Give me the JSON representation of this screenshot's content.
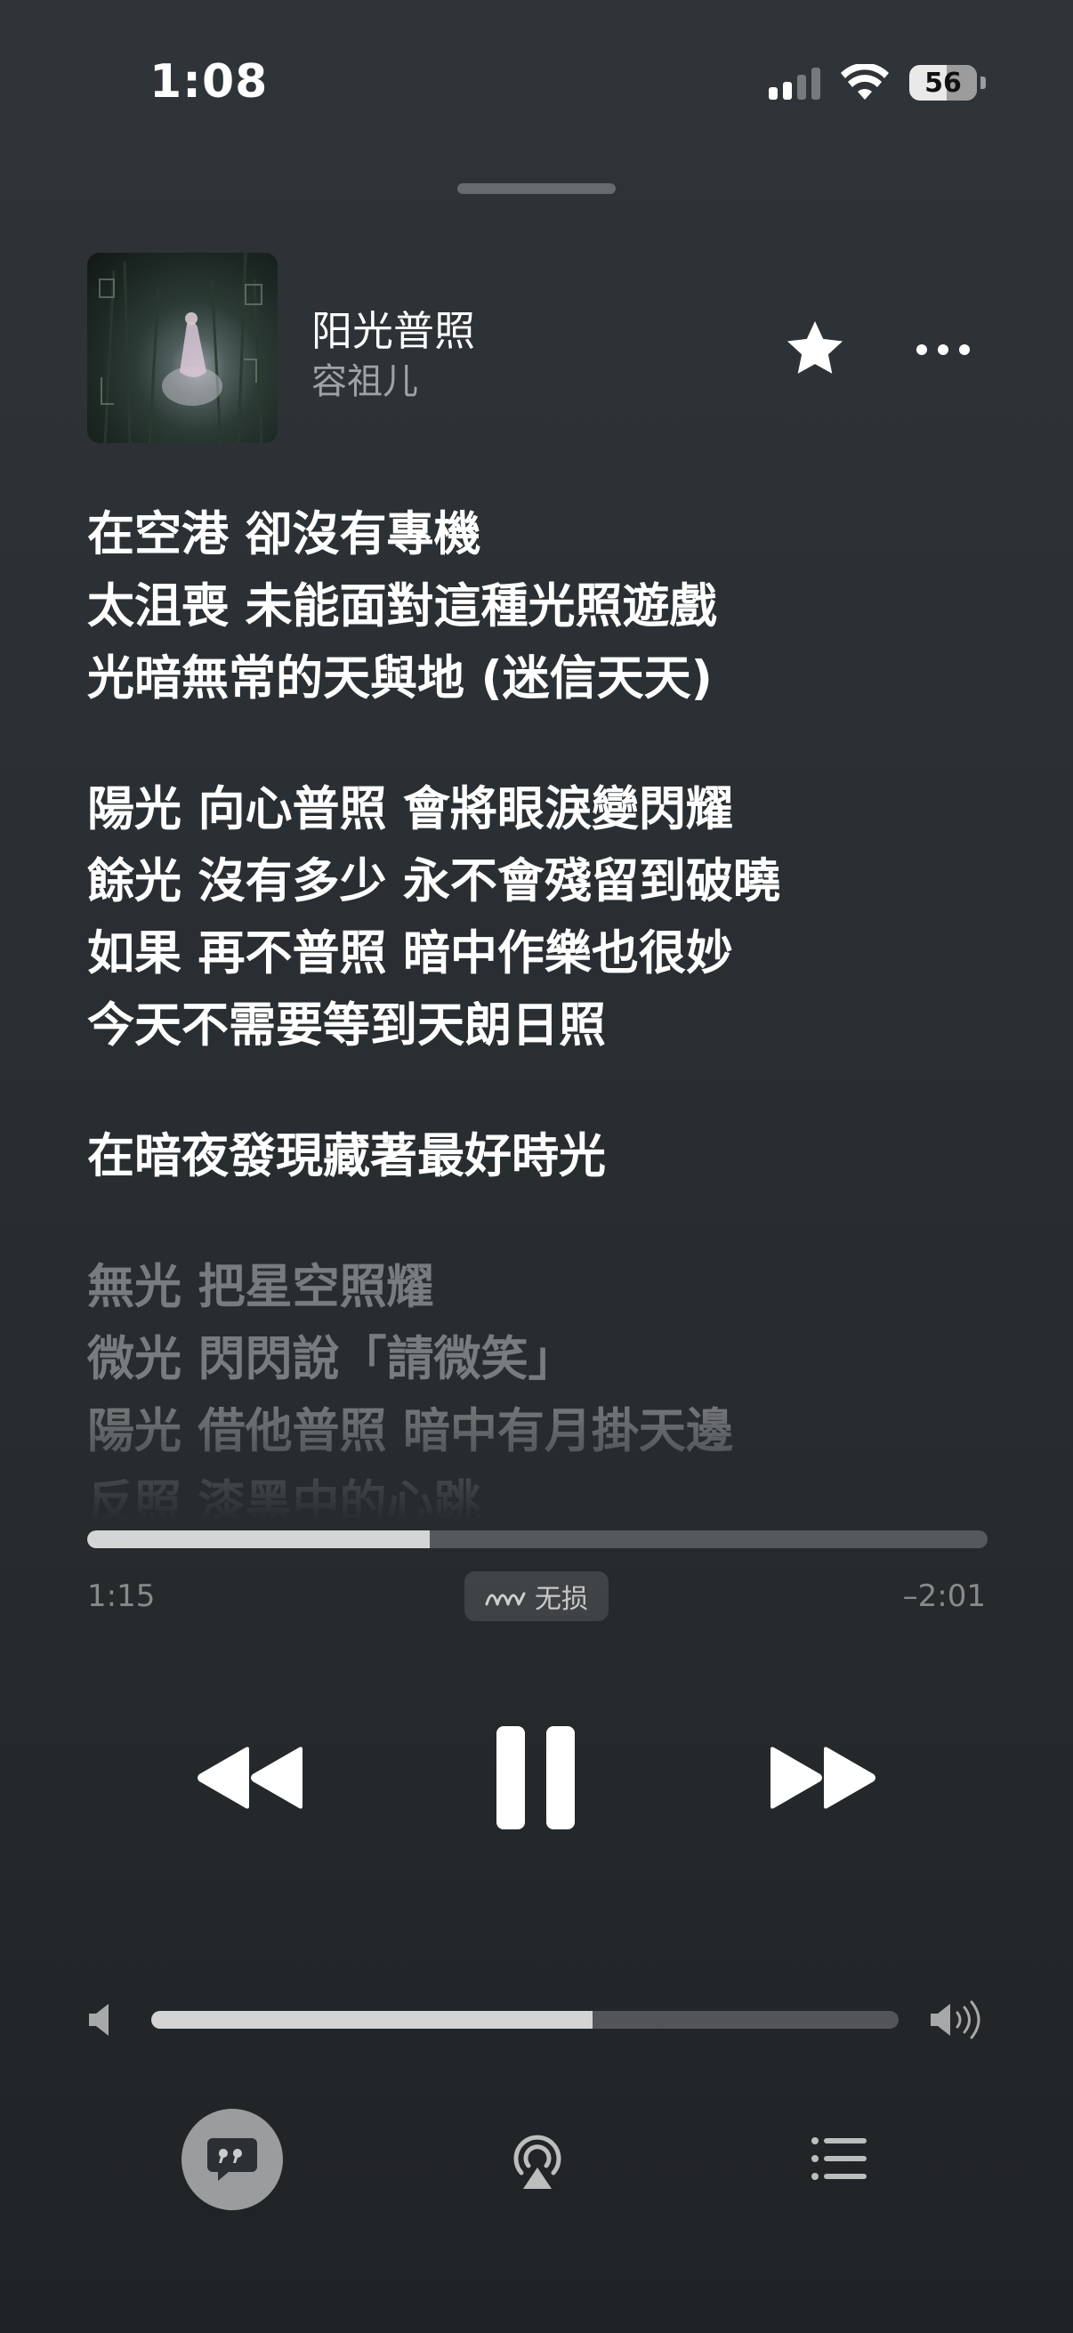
{
  "status_bar": {
    "time": "1:08",
    "battery_percent": "56",
    "icons": [
      "cellular-signal-icon",
      "wifi-icon",
      "battery-icon"
    ]
  },
  "now_playing": {
    "title": "阳光普照",
    "artist": "容祖儿",
    "favorite_icon": "star-icon",
    "more_icon": "ellipsis-icon"
  },
  "lyrics": {
    "blocks": [
      [
        "在空港 卻沒有專機",
        "太沮喪 未能面對這種光照遊戲",
        "光暗無常的天與地 (迷信天天)"
      ],
      [
        "陽光 向心普照 會將眼淚變閃耀",
        "餘光 沒有多少 永不會殘留到破曉",
        "如果 再不普照 暗中作樂也很妙",
        "今天不需要等到天朗日照"
      ],
      [
        "在暗夜發現藏著最好時光"
      ],
      [
        "無光 把星空照耀",
        "微光 閃閃說「請微笑」",
        "陽光 借他普照 暗中有月掛天邊",
        "反照 漆黑中的心跳"
      ]
    ]
  },
  "playback": {
    "elapsed": "1:15",
    "remaining": "–2:01",
    "progress_fraction": 0.38,
    "quality_badge": "无损",
    "quality_icon": "lossless-waveform-icon",
    "controls": [
      "rewind-icon",
      "pause-icon",
      "fast-forward-icon"
    ]
  },
  "volume": {
    "level_fraction": 0.59,
    "icons": [
      "speaker-min-icon",
      "speaker-max-icon"
    ]
  },
  "bottom_bar": {
    "items": [
      "lyrics-quote-icon",
      "airplay-icon",
      "queue-list-icon"
    ]
  },
  "colors": {
    "background_top": "#2f3438",
    "background_bottom": "#202325",
    "text_primary": "#ffffff",
    "text_secondary": "rgba(255,255,255,0.55)"
  }
}
